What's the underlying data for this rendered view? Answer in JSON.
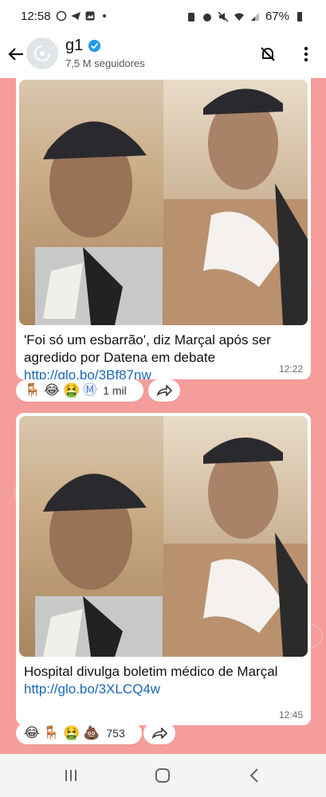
{
  "status_bar": {
    "time": "12:58",
    "battery": "67%"
  },
  "header": {
    "channel_name": "g1",
    "followers": "7,5 M seguidores",
    "icons": [
      "back-arrow-icon",
      "channel-avatar-icon",
      "verified-badge-icon",
      "mute-bell-icon",
      "more-vert-icon"
    ]
  },
  "messages": [
    {
      "caption": "'Foi só um esbarrão', diz Marçal após ser agredido por Datena em debate",
      "link": "http://glo.bo/3Bf87nw",
      "time": "12:22",
      "reactions": [
        "🪑",
        "😂",
        "🤮",
        "Ⓜ"
      ],
      "reaction_count": "1 mil"
    },
    {
      "caption": "Hospital divulga boletim médico de Marçal",
      "link": "http://glo.bo/3XLCQ4w",
      "time": "12:45",
      "reactions": [
        "😂",
        "🪑",
        "🤮",
        "💩"
      ],
      "reaction_count": "753"
    }
  ],
  "colors": {
    "chat_background": "#f59d9b",
    "link": "#1c67b5",
    "verified": "#1d9bf0"
  }
}
